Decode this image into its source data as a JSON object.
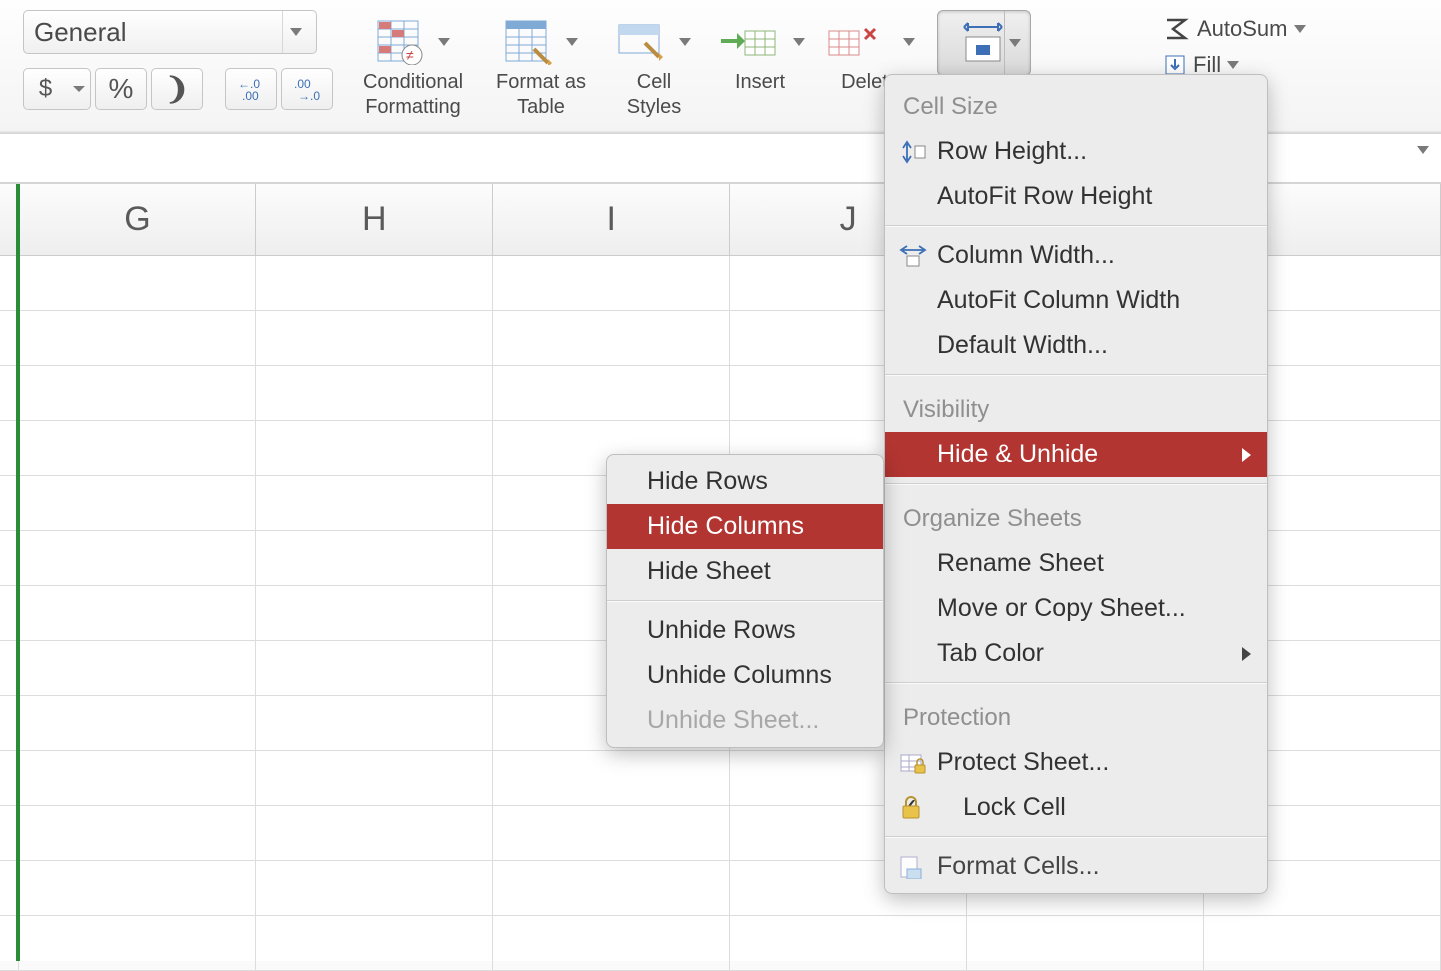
{
  "ribbon": {
    "number_format": "General",
    "currency_symbol": "$",
    "percent_symbol": "%",
    "comma_symbol": "❩",
    "conditional_formatting": "Conditional Formatting",
    "format_as_table": "Format as Table",
    "cell_styles": "Cell Styles",
    "insert": "Insert",
    "delete": "Delete",
    "autosum": "AutoSum",
    "fill": "Fill"
  },
  "columns": [
    "G",
    "H",
    "I",
    "J"
  ],
  "format_menu": {
    "cell_size_header": "Cell Size",
    "row_height": "Row Height...",
    "autofit_row_height": "AutoFit Row Height",
    "column_width": "Column Width...",
    "autofit_column_width": "AutoFit Column Width",
    "default_width": "Default Width...",
    "visibility_header": "Visibility",
    "hide_unhide": "Hide & Unhide",
    "organize_header": "Organize Sheets",
    "rename_sheet": "Rename Sheet",
    "move_copy_sheet": "Move or Copy Sheet...",
    "tab_color": "Tab Color",
    "protection_header": "Protection",
    "protect_sheet": "Protect Sheet...",
    "lock_cell": "Lock Cell",
    "format_cells": "Format Cells..."
  },
  "hide_submenu": {
    "hide_rows": "Hide Rows",
    "hide_columns": "Hide Columns",
    "hide_sheet": "Hide Sheet",
    "unhide_rows": "Unhide Rows",
    "unhide_columns": "Unhide Columns",
    "unhide_sheet": "Unhide Sheet..."
  }
}
